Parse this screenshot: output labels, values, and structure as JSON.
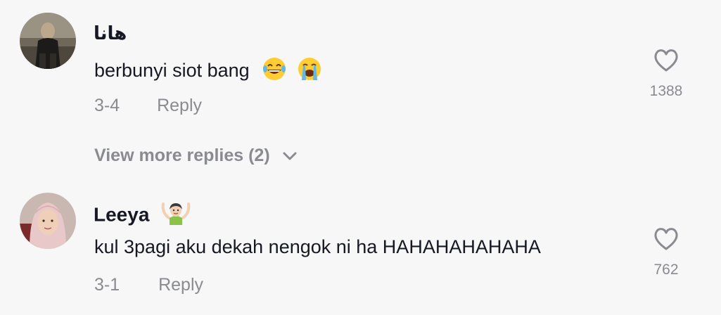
{
  "comments": [
    {
      "username": "هانا",
      "text": "berbunyi siot bang",
      "date": "3-4",
      "reply_label": "Reply",
      "like_count": "1388",
      "text_emojis": [
        "face-with-tears-of-joy-icon",
        "loudly-crying-face-icon"
      ]
    },
    {
      "username": "Leeya",
      "username_emoji": "person-gesturing-ok-icon",
      "text": "kul 3pagi aku dekah nengok ni ha HAHAHAHAHAHA",
      "date": "3-1",
      "reply_label": "Reply",
      "like_count": "762"
    }
  ],
  "view_more": {
    "label": "View more replies (2)"
  },
  "colors": {
    "background": "#f7f7f7",
    "primary_text": "#161823",
    "secondary_text": "#8a8b91"
  }
}
